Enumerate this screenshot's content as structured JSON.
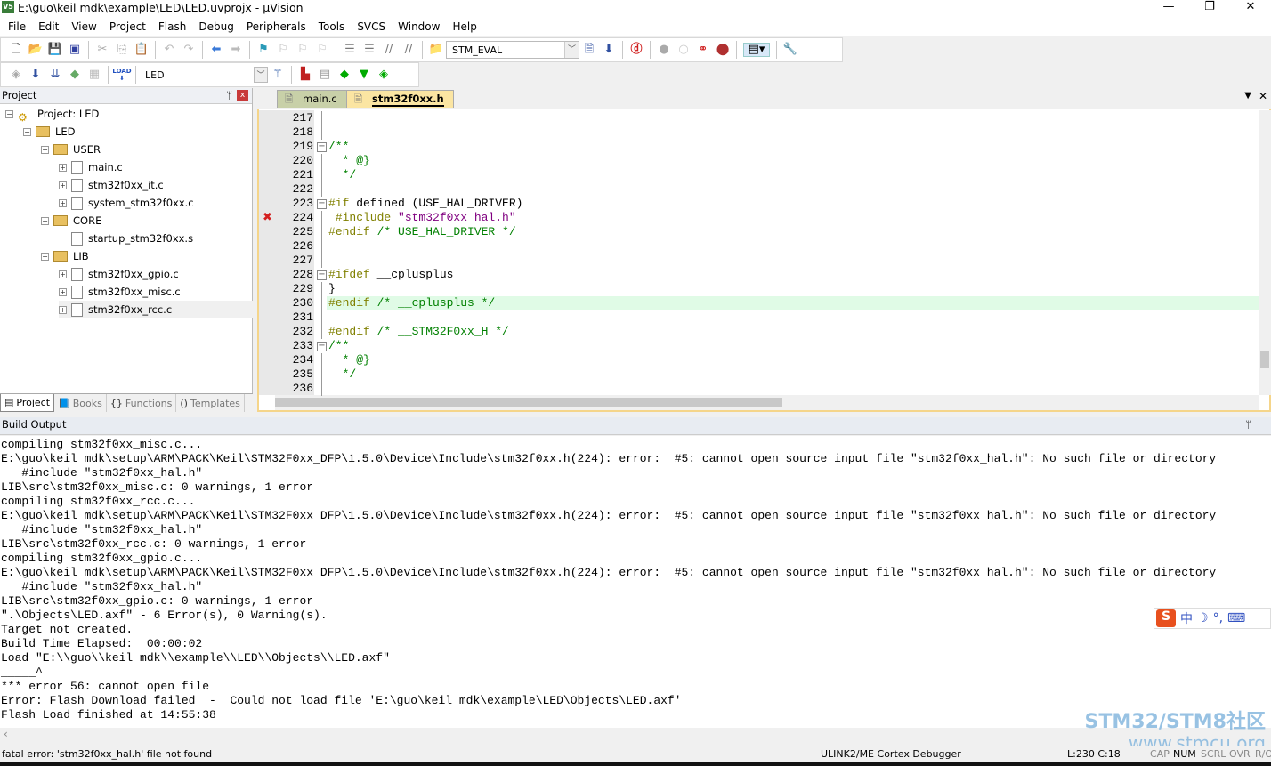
{
  "window": {
    "title": "E:\\guo\\keil mdk\\example\\LED\\LED.uvprojx - µVision",
    "logo": "V5",
    "minimize": "—",
    "restore": "❐",
    "close": "✕"
  },
  "menu": [
    "File",
    "Edit",
    "View",
    "Project",
    "Flash",
    "Debug",
    "Peripherals",
    "Tools",
    "SVCS",
    "Window",
    "Help"
  ],
  "toolbar1": {
    "target_combo": "STM_EVAL"
  },
  "toolbar2": {
    "target_combo": "LED",
    "load_label": "LOAD"
  },
  "project_panel": {
    "title": "Project",
    "pin": "ᛘ",
    "close": "x",
    "tree": [
      {
        "label": "Project: LED",
        "level": 0,
        "type": "root",
        "expander": "−"
      },
      {
        "label": "LED",
        "level": 1,
        "type": "target",
        "expander": "−"
      },
      {
        "label": "USER",
        "level": 2,
        "type": "folder",
        "expander": "−"
      },
      {
        "label": "main.c",
        "level": 3,
        "type": "file",
        "expander": "+"
      },
      {
        "label": "stm32f0xx_it.c",
        "level": 3,
        "type": "file",
        "expander": "+"
      },
      {
        "label": "system_stm32f0xx.c",
        "level": 3,
        "type": "file",
        "expander": "+"
      },
      {
        "label": "CORE",
        "level": 2,
        "type": "folder",
        "expander": "−"
      },
      {
        "label": "startup_stm32f0xx.s",
        "level": 3,
        "type": "file",
        "expander": ""
      },
      {
        "label": "LIB",
        "level": 2,
        "type": "folder",
        "expander": "−"
      },
      {
        "label": "stm32f0xx_gpio.c",
        "level": 3,
        "type": "file",
        "expander": "+"
      },
      {
        "label": "stm32f0xx_misc.c",
        "level": 3,
        "type": "file",
        "expander": "+"
      },
      {
        "label": "stm32f0xx_rcc.c",
        "level": 3,
        "type": "file",
        "expander": "+",
        "selected": true
      }
    ],
    "tabs": [
      {
        "label": "Project",
        "active": true
      },
      {
        "label": "Books"
      },
      {
        "label": "Functions"
      },
      {
        "label": "Templates"
      }
    ]
  },
  "editor": {
    "tabs": [
      {
        "label": "main.c",
        "active": false
      },
      {
        "label": "stm32f0xx.h",
        "active": true
      }
    ],
    "current_line": 230,
    "error_line": 224,
    "lines": [
      {
        "n": "217",
        "tokens": []
      },
      {
        "n": "218",
        "tokens": []
      },
      {
        "n": "219",
        "fold": "−",
        "tokens": [
          [
            "/**",
            "cm"
          ]
        ]
      },
      {
        "n": "220",
        "tokens": [
          [
            "  * @}",
            "cm"
          ]
        ]
      },
      {
        "n": "221",
        "tokens": [
          [
            "  */",
            "cm"
          ]
        ]
      },
      {
        "n": "222",
        "tokens": []
      },
      {
        "n": "223",
        "fold": "−",
        "tokens": [
          [
            "#if",
            "kw"
          ],
          [
            " defined (USE_HAL_DRIVER)",
            "pl"
          ]
        ]
      },
      {
        "n": "224",
        "tokens": [
          [
            " #include",
            "kw"
          ],
          [
            " \"stm32f0xx_hal.h\"",
            "st"
          ]
        ]
      },
      {
        "n": "225",
        "tokens": [
          [
            "#endif",
            "kw"
          ],
          [
            " /* USE_HAL_DRIVER */",
            "cm"
          ]
        ]
      },
      {
        "n": "226",
        "tokens": []
      },
      {
        "n": "227",
        "tokens": []
      },
      {
        "n": "228",
        "fold": "−",
        "tokens": [
          [
            "#ifdef",
            "kw"
          ],
          [
            " __cplusplus",
            "pl"
          ]
        ]
      },
      {
        "n": "229",
        "tokens": [
          [
            "}",
            "pl"
          ]
        ]
      },
      {
        "n": "230",
        "tokens": [
          [
            "#endif",
            "kw"
          ],
          [
            " /* __cplusplus */",
            "cm"
          ]
        ]
      },
      {
        "n": "231",
        "tokens": []
      },
      {
        "n": "232",
        "tokens": [
          [
            "#endif",
            "kw"
          ],
          [
            " /* __STM32F0xx_H */",
            "cm"
          ]
        ]
      },
      {
        "n": "233",
        "fold": "−",
        "tokens": [
          [
            "/**",
            "cm"
          ]
        ]
      },
      {
        "n": "234",
        "tokens": [
          [
            "  * @}",
            "cm"
          ]
        ]
      },
      {
        "n": "235",
        "tokens": [
          [
            "  */",
            "cm"
          ]
        ]
      },
      {
        "n": "236",
        "tokens": []
      }
    ]
  },
  "build_output": {
    "title": "Build Output",
    "pin": "ᛘ",
    "lines": [
      "compiling stm32f0xx_misc.c...",
      "E:\\guo\\keil mdk\\setup\\ARM\\PACK\\Keil\\STM32F0xx_DFP\\1.5.0\\Device\\Include\\stm32f0xx.h(224): error:  #5: cannot open source input file \"stm32f0xx_hal.h\": No such file or directory",
      "   #include \"stm32f0xx_hal.h\"",
      "LIB\\src\\stm32f0xx_misc.c: 0 warnings, 1 error",
      "compiling stm32f0xx_rcc.c...",
      "E:\\guo\\keil mdk\\setup\\ARM\\PACK\\Keil\\STM32F0xx_DFP\\1.5.0\\Device\\Include\\stm32f0xx.h(224): error:  #5: cannot open source input file \"stm32f0xx_hal.h\": No such file or directory",
      "   #include \"stm32f0xx_hal.h\"",
      "LIB\\src\\stm32f0xx_rcc.c: 0 warnings, 1 error",
      "compiling stm32f0xx_gpio.c...",
      "E:\\guo\\keil mdk\\setup\\ARM\\PACK\\Keil\\STM32F0xx_DFP\\1.5.0\\Device\\Include\\stm32f0xx.h(224): error:  #5: cannot open source input file \"stm32f0xx_hal.h\": No such file or directory",
      "   #include \"stm32f0xx_hal.h\"",
      "LIB\\src\\stm32f0xx_gpio.c: 0 warnings, 1 error",
      "\".\\Objects\\LED.axf\" - 6 Error(s), 0 Warning(s).",
      "Target not created.",
      "Build Time Elapsed:  00:00:02",
      "Load \"E:\\\\guo\\\\keil mdk\\\\example\\\\LED\\\\Objects\\\\LED.axf\"",
      "_____^",
      "*** error 56: cannot open file",
      "Error: Flash Download failed  -  Could not load file 'E:\\guo\\keil mdk\\example\\LED\\Objects\\LED.axf'",
      "Flash Load finished at 14:55:38"
    ]
  },
  "status": {
    "message": "fatal error: 'stm32f0xx_hal.h' file not found",
    "debugger": "ULINK2/ME Cortex Debugger",
    "position": "L:230 C:18",
    "cap": "CAP",
    "num": "NUM",
    "scrl": "SCRL",
    "ovr": "OVR",
    "rw": "R/O"
  },
  "watermark": {
    "line1": "STM32/STM8社区",
    "line2": "www.stmcu.org"
  },
  "ime": {
    "label": "中"
  },
  "colors": {
    "keyword": "#808000",
    "comment": "#008000",
    "string": "#800080",
    "current_line": "#e0fbe6",
    "error_marker": "#d42020",
    "tab_active": "#fbe5a2"
  }
}
